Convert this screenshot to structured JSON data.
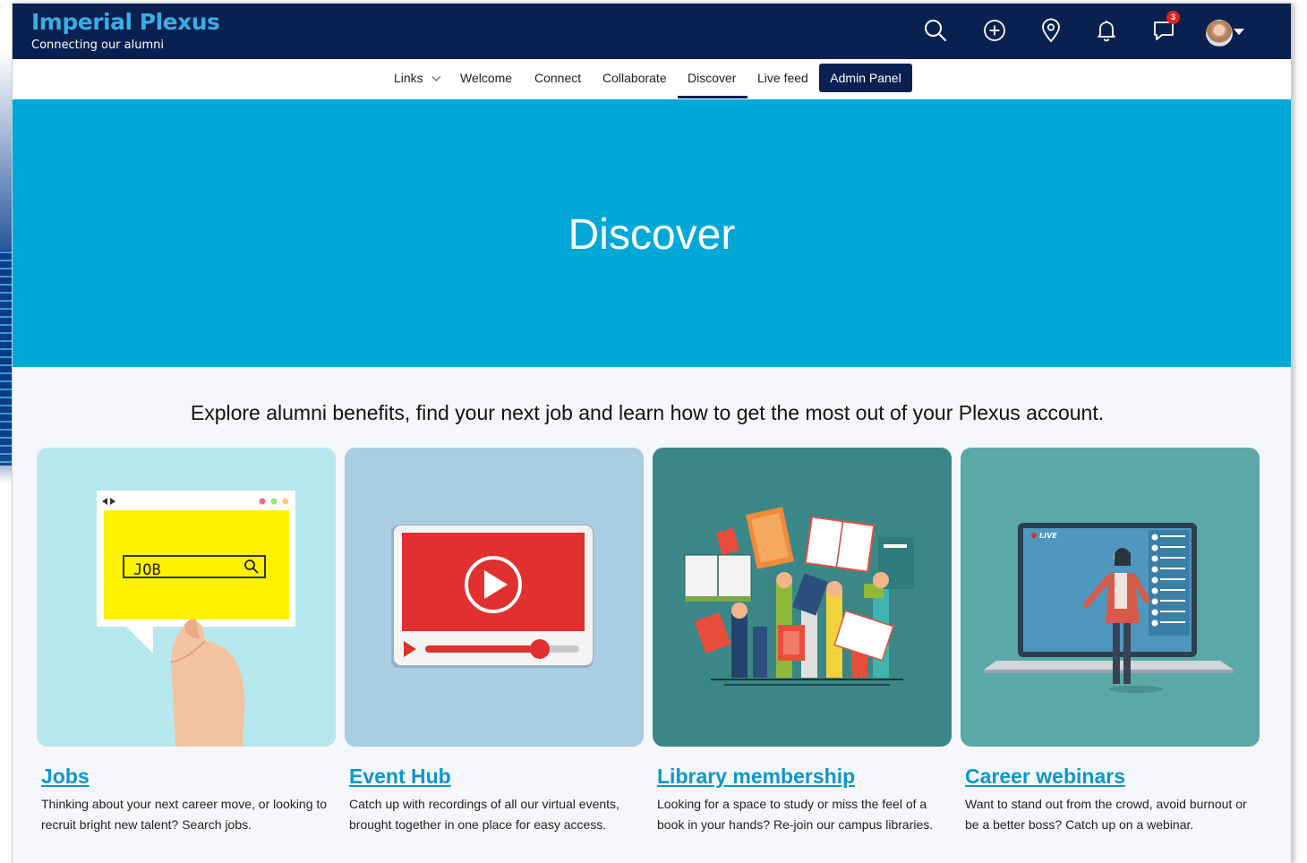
{
  "brand": {
    "title": "Imperial Plexus",
    "subtitle": "Connecting our alumni"
  },
  "header_icons": {
    "search": "search-icon",
    "add": "plus-circle-icon",
    "location": "map-pin-icon",
    "notifications": "bell-icon",
    "messages": "chat-icon",
    "messages_badge": "3",
    "avatar": "user-avatar"
  },
  "nav": {
    "links": "Links",
    "welcome": "Welcome",
    "connect": "Connect",
    "collaborate": "Collaborate",
    "discover": "Discover",
    "live_feed": "Live feed",
    "admin_panel": "Admin Panel",
    "active": "Discover"
  },
  "hero": {
    "title": "Discover"
  },
  "intro": "Explore alumni benefits, find your next job and learn how to get the most out of your Plexus account.",
  "cards": [
    {
      "title": "Jobs",
      "description": "Thinking about your next career move, or looking to recruit bright new talent? Search jobs.",
      "image_text": "JOB",
      "bg": "#b7e8ee"
    },
    {
      "title": "Event Hub",
      "description": "Catch up with recordings of all our virtual events, brought together in one place for easy access.",
      "bg": "#a9cde2"
    },
    {
      "title": "Library membership",
      "description": "Looking for a space to study or miss the feel of a book in your hands? Re-join our campus libraries.",
      "bg": "#3b8787"
    },
    {
      "title": "Career webinars",
      "description": "Want to stand out from the crowd, avoid burnout or be a better boss? Catch up on a webinar.",
      "image_text": "LIVE",
      "bg": "#5aa9a7"
    }
  ],
  "colors": {
    "header_bg": "#0a2050",
    "brand_accent": "#38aee3",
    "hero_bg": "#00a8d8",
    "link": "#0e97c9",
    "badge": "#e02020"
  }
}
